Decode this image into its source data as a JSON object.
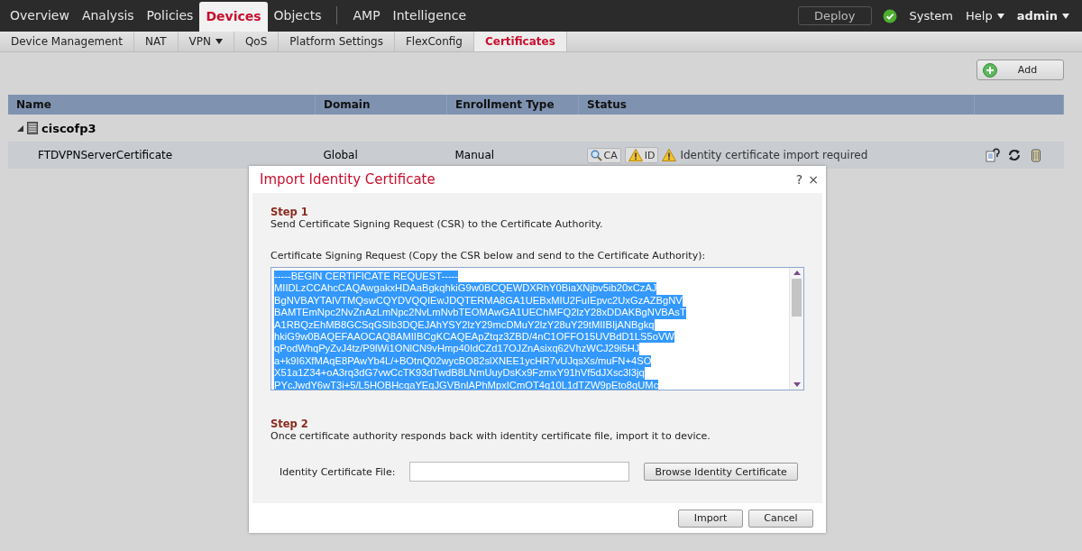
{
  "nav": {
    "items": [
      {
        "label": "Overview",
        "selected": false
      },
      {
        "label": "Analysis",
        "selected": false
      },
      {
        "label": "Policies",
        "selected": false
      },
      {
        "label": "Devices",
        "selected": true
      },
      {
        "label": "Objects",
        "selected": false
      },
      {
        "label": "AMP",
        "selected": false
      },
      {
        "label": "Intelligence",
        "selected": false
      }
    ],
    "deploy": "Deploy",
    "system": "System",
    "help": "Help",
    "user": "admin"
  },
  "subnav": [
    {
      "label": "Device Management",
      "selected": false,
      "menu": false
    },
    {
      "label": "NAT",
      "selected": false,
      "menu": false
    },
    {
      "label": "VPN",
      "selected": false,
      "menu": true
    },
    {
      "label": "QoS",
      "selected": false,
      "menu": false
    },
    {
      "label": "Platform Settings",
      "selected": false,
      "menu": false
    },
    {
      "label": "FlexConfig",
      "selected": false,
      "menu": false
    },
    {
      "label": "Certificates",
      "selected": true,
      "menu": false
    }
  ],
  "add_button": "Add",
  "table": {
    "columns": [
      "Name",
      "Domain",
      "Enrollment Type",
      "Status"
    ],
    "groups": [
      {
        "name": "ciscofp3",
        "expanded": true,
        "rows": [
          {
            "name": "FTDVPNServerCertificate",
            "domain": "Global",
            "enrollment_type": "Manual",
            "badges": [
              {
                "kind": "search",
                "label": "CA"
              },
              {
                "kind": "warning",
                "label": "ID"
              }
            ],
            "status": "Identity certificate import required"
          }
        ]
      }
    ]
  },
  "dialog": {
    "title": "Import Identity Certificate",
    "help": "?",
    "close": "×",
    "step1": {
      "heading": "Step 1",
      "text": "Send Certificate Signing Request (CSR) to the Certificate Authority."
    },
    "csr_label": "Certificate Signing Request (Copy the CSR below and send to the Certificate Authority):",
    "csr_lines": [
      "-----BEGIN CERTIFICATE REQUEST-----",
      "MIIDLzCCAhcCAQAwgakxHDAaBgkqhkiG9w0BCQEWDXRhY0BiaXNjbv5ib20xCzAJ",
      "BgNVBAYTAlVTMQswCQYDVQQIEwJDQTERMA8GA1UEBxMIU2FuIEpvc2UxGzAZBgNV",
      "BAMTEmNpc2NvZnAzLmNpc2NvLmNvbTEOMAwGA1UEChMFQ2lzY28xDDAKBgNVBAsT",
      "A1RBQzEhMB8GCSqGSIb3DQEJAhYSY2lzY29mcDMuY2lzY28uY29tMIIBIjANBgkq",
      "hkiG9w0BAQEFAAOCAQ8AMIIBCgKCAQEApZtqz3ZBD/4nC1OFFO15UVBdD1LS5oVW",
      "qPodWhqPyZvJ4tz/P9lWi1ONlCN9vHmp40IdCZd17OJZnAsixq62VhzWCJ29i5HJ",
      "a+k9I6XfMAqE8PAwYb4L/+BOtnQ02wycBO82slXNEE1ycHR7vUJqsXs/muFN+4SO",
      "X51a1Z34+oA3rq3dG7vwCcTK93dTwdB8LNmUuyDsKx9FzmxY91hVf5dJXsc3l3jq",
      "PYcJwdY6wT3i+5/L5HOBHcqaYEqJGVBnlAPhMpxICmOT4q10L1dTZW9pEto8qUMc"
    ],
    "csr_selected": true,
    "step2": {
      "heading": "Step 2",
      "text": "Once certificate authority responds back with identity certificate file, import it to device."
    },
    "file_label": "Identity Certificate File:",
    "browse": "Browse Identity Certificate",
    "buttons": [
      "Import",
      "Cancel"
    ]
  }
}
